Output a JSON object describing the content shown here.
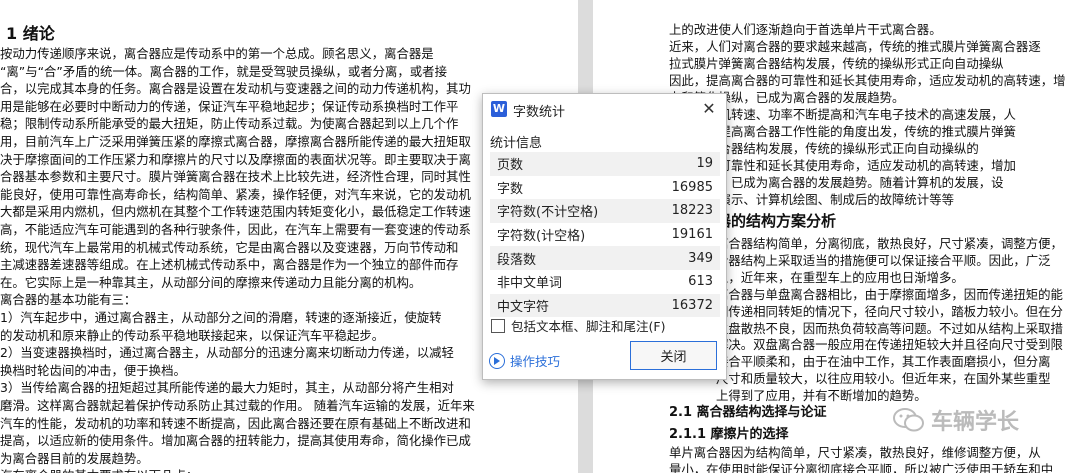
{
  "document": {
    "left_page": {
      "heading": "1  绪论",
      "lines": [
        "        按动力传递顺序来说，离合器应是传动系中的第一个总成。顾名思义，离合器是",
        "“离”与“合”矛盾的统一体。离合器的工作，就是受驾驶员操纵，或者分离，或者接",
        "合，以完成其本身的任务。离合器是设置在发动机与变速器之间的动力传递机构，其功",
        "用是能够在必要时中断动力的传递，保证汽车平稳地起步；保证传动系换档时工作平",
        "稳；限制传动系所能承受的最大扭矩，防止传动系过载。为使离合器起到以上几个作",
        "用，目前汽车上广泛采用弹簧压紧的摩擦式离合器，摩擦离合器所能传递的最大扭矩取",
        "决于摩擦面间的工作压紧力和摩擦片的尺寸以及摩擦面的表面状况等。即主要取决于离",
        "合器基本参数和主要尺寸。膜片弹簧离合器在技术上比较先进，经济性合理，同时其性",
        "能良好，使用可靠性高寿命长，结构简单、紧凑，操作轻便，对汽车来说，它的发动机",
        "大都是采用内燃机，但内燃机在其整个工作转速范围内转矩变化小，最低稳定工作转速",
        "高，不能适应汽车可能遇到的各种行驶条件，因此，在汽车上需要有一套变速的传动系",
        "统，现代汽车上最常用的机械式传动系统，它是由离合器以及变速器，万向节传动和",
        "主减速器差速器等组成。在上述机械式传动系中，离合器是作为一个独立的部件而存",
        "在。它实际上是一种靠其主，从动部分间的摩擦来传递动力且能分离的机构。",
        "    离合器的基本功能有三：",
        "    1）汽车起步中，通过离合器主，从动部分之间的滑磨，转速的逐渐接近，使旋转",
        "的发动机和原来静止的传动系平稳地联接起来，以保证汽车平稳起步。",
        "    2）当变速器换档时，通过离合器主，从动部分的迅速分离来切断动力传递，以减轻",
        "换档时轮齿间的冲击，便于换档。",
        "    3）当传给离合器的扭矩超过其所能传递的最大力矩时，其主，从动部分将产生相对",
        "磨滑。这样离合器就起着保护传动系防止其过载的作用。  随着汽车运输的发展，近年来",
        "汽车的性能，发动机的功率和转速不断提高，因此离合器还要在原有基础上不断改进和",
        "提高，以适应新的使用条件。增加离合器的扭转能力，提高其使用寿命，简化操作已成",
        "为离合器目前的发展趋势。",
        "    汽车离合器的基本要求有以下几点："
      ]
    },
    "right_page": {
      "lines_top": [
        "上的改进使人们逐渐趋向于首选单片干式离合器。",
        "        近来，人们对离合器的要求越来越高，传统的推式膜片弹簧离合器逐",
        "拉式膜片弹簧离合器结构发展，传统的操纵形式正向自动操纵",
        "因此，提高离合器的可靠性和延长其使用寿命，适应发动机的高转速，增",
        "力和简化操纵，已成为离合器的发展趋势。",
        "汽车发动机转速、功率不断提高和汽车电子技术的高速发展，人",
        "越高。从提高离合器工作性能的角度出发，传统的推式膜片弹簧",
        "片弹簧离合器结构发展，传统的操纵形式正向自动操纵的",
        "离合器的可靠性和延长其使用寿命，适应发动机的高转速，增加",
        "简化操纵，已成为离合器的发展趋势。随着计算机的发展，设",
        "算、性能演示、计算机绘图、制成后的故障统计等等"
      ],
      "heading_2": "器的结构方案分析",
      "lines_mid": [
        "离合器结构简单，分离彻底，散热良好，尺寸紧凑，调整方便，",
        "合器结构上采取适当的措施便可以保证接合平顺。因此，广泛",
        "上，近年来，在重型车上的应用也日渐增多。",
        "离合器与单盘离合器相比，由于摩擦面增多，因而传递扭矩的能",
        "同传递相同转矩的情况下，径向尺寸较小，踏板力较小。但在分",
        "主盘散热不良，因而热负荷较高等问题。不过如从结构上采取措",
        "解决。双盘离合器一般应用在传递扭矩较大并且径向尺寸受到限",
        "接合平顺柔和，由于在油中工作，其工作表面磨损小，但分离",
        "尺寸和质量较大，以往应用较小。但近年来，在国外某些重型",
        "上得到了应用，并有不断增加的趋势。"
      ],
      "heading_21": "2.1  离合器结构选择与论证",
      "heading_211": "2.1.1    摩擦片的选择",
      "lines_bottom": [
        "        单片离合器因为结构简单，尺寸紧凑，散热良好，维修调整方便，从",
        "量小，在使用时能保证分离彻底接合平顺，所以被广泛使用于轿车和中"
      ]
    }
  },
  "dialog": {
    "title": "字数统计",
    "app_icon": "W",
    "section_title": "统计信息",
    "stats": [
      {
        "label": "页数",
        "value": "19"
      },
      {
        "label": "字数",
        "value": "16985"
      },
      {
        "label": "字符数(不计空格)",
        "value": "18223"
      },
      {
        "label": "字符数(计空格)",
        "value": "19161"
      },
      {
        "label": "段落数",
        "value": "349"
      },
      {
        "label": "非中文单词",
        "value": "613"
      },
      {
        "label": "中文字符",
        "value": "16372"
      }
    ],
    "checkbox_label": "包括文本框、脚注和尾注(F)",
    "tips_label": "操作技巧",
    "close_button": "关闭",
    "close_glyph": "✕"
  },
  "watermark": {
    "text": "车辆学长"
  },
  "colors": {
    "accent": "#2b6fd9",
    "app_icon_bg": "#2b5fd9"
  }
}
